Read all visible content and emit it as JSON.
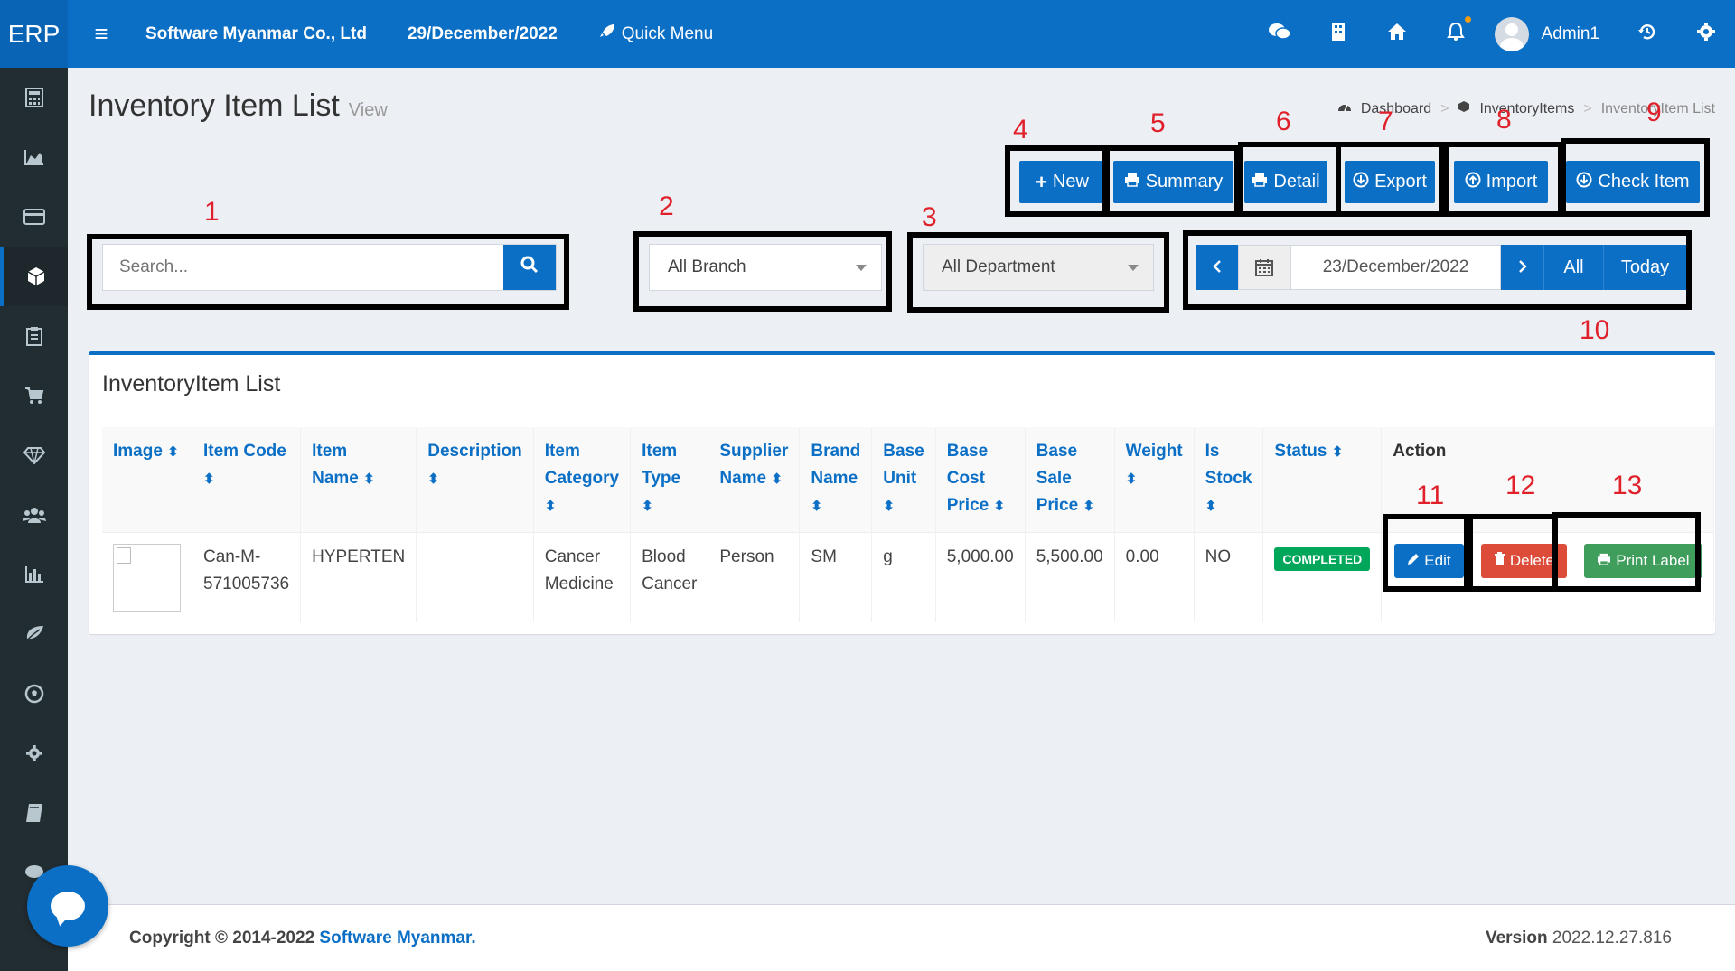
{
  "header": {
    "logo": "ERP",
    "company": "Software Myanmar Co., Ltd",
    "date": "29/December/2022",
    "quick_menu": "Quick Menu",
    "user": "Admin1",
    "icons": [
      "wechat-icon",
      "building-icon",
      "home-icon",
      "bell-icon",
      "history-icon",
      "gear-icon"
    ]
  },
  "sidebar": {
    "icons": [
      "calculator-icon",
      "area-chart-icon",
      "credit-card-icon",
      "cube-icon",
      "clipboard-icon",
      "cart-icon",
      "diamond-icon",
      "users-icon",
      "bar-chart-icon",
      "leaf-icon",
      "soccer-icon",
      "cog-icon",
      "book-icon",
      "comment-icon"
    ],
    "active_index": 3
  },
  "page": {
    "title": "Inventory Item List",
    "subtitle": "View"
  },
  "breadcrumb": {
    "dashboard": "Dashboard",
    "items": "InventoryItems",
    "current": "InventoryItem List"
  },
  "toolbar": {
    "new": "New",
    "summary": "Summary",
    "detail": "Detail",
    "export": "Export",
    "import": "Import",
    "check_item": "Check Item"
  },
  "filters": {
    "search_placeholder": "Search...",
    "branch": "All Branch",
    "department": "All Department",
    "date": "23/December/2022",
    "all": "All",
    "today": "Today"
  },
  "annotations": [
    "1",
    "2",
    "3",
    "4",
    "5",
    "6",
    "7",
    "8",
    "9",
    "10",
    "11",
    "12",
    "13"
  ],
  "list": {
    "title": "InventoryItem List",
    "headers": {
      "image": "Image",
      "item_code": "Item Code",
      "item_name_1": "Item",
      "item_name_2": "Name",
      "description": "Description",
      "category_1": "Item",
      "category_2": "Category",
      "type_1": "Item",
      "type_2": "Type",
      "supplier_1": "Supplier",
      "supplier_2": "Name",
      "brand_1": "Brand",
      "brand_2": "Name",
      "unit_1": "Base",
      "unit_2": "Unit",
      "cost_1": "Base",
      "cost_2": "Cost",
      "cost_3": "Price",
      "sale_1": "Base",
      "sale_2": "Sale",
      "sale_3": "Price",
      "weight": "Weight",
      "stock_1": "Is",
      "stock_2": "Stock",
      "status": "Status",
      "action": "Action"
    },
    "rows": [
      {
        "item_code_1": "Can-M-",
        "item_code_2": "571005736",
        "item_name": "HYPERTEN",
        "description": "",
        "category_1": "Cancer",
        "category_2": "Medicine",
        "type_1": "Blood",
        "type_2": "Cancer",
        "supplier": "Person",
        "brand": "SM",
        "unit": "g",
        "cost": "5,000.00",
        "sale": "5,500.00",
        "weight": "0.00",
        "is_stock": "NO",
        "status": "COMPLETED",
        "edit": "Edit",
        "delete": "Delete",
        "print": "Print Label"
      }
    ]
  },
  "footer": {
    "copyright": "Copyright © 2014-2022",
    "company_link": "Software Myanmar.",
    "version_label": "Version",
    "version": "2022.12.27.816"
  },
  "colors": {
    "primary": "#0b6fc6",
    "sidebar": "#222d32",
    "success": "#00a65a",
    "danger": "#dd4b39",
    "print": "#3f9e5c",
    "annotation": "#e0202a"
  }
}
